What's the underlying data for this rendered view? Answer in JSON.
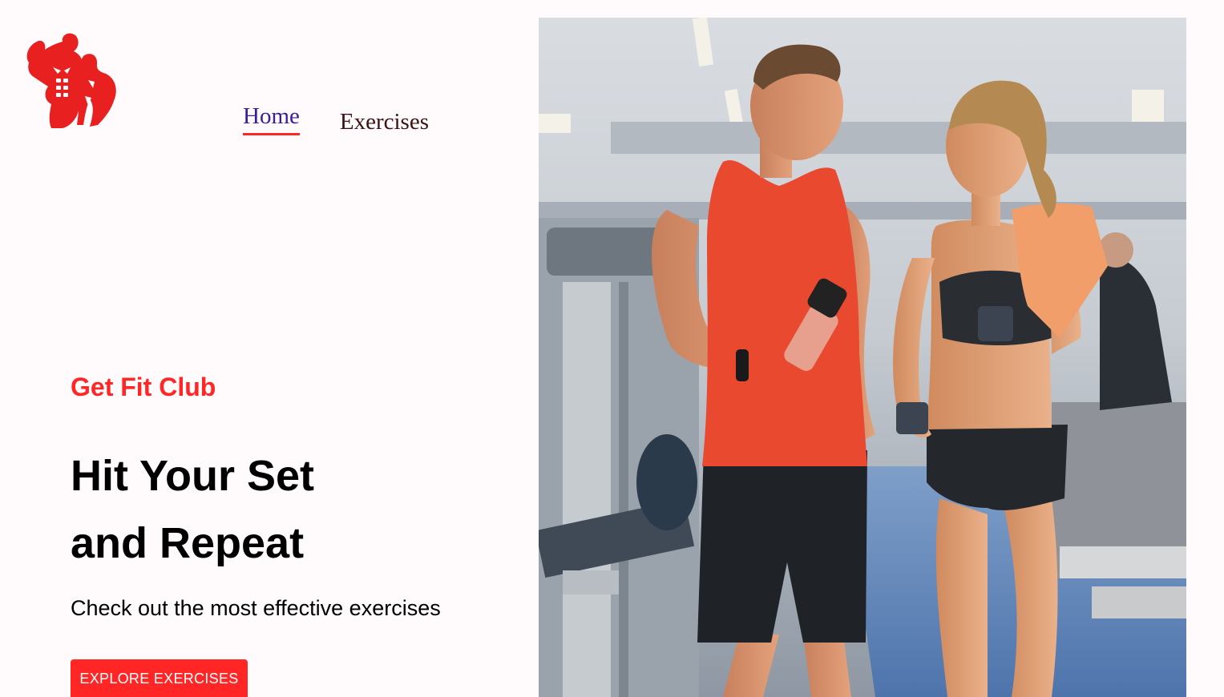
{
  "header": {
    "logo_icon": "bodybuilders-logo-icon",
    "nav": [
      {
        "label": "Home",
        "active": true
      },
      {
        "label": "Exercises",
        "active": false
      }
    ]
  },
  "hero": {
    "brand": "Get Fit Club",
    "headline_line1": "Hit Your Set",
    "headline_line2": "and Repeat",
    "subtext": "Check out the most effective exercises",
    "cta_label": "EXPLORE EXERCISES"
  },
  "banner": {
    "image_icon": "gym-couple-photo"
  },
  "colors": {
    "accent": "#ff2625",
    "background": "#fffafb",
    "nav_active": "#3a1d9c",
    "nav_inactive": "#3a1212"
  }
}
